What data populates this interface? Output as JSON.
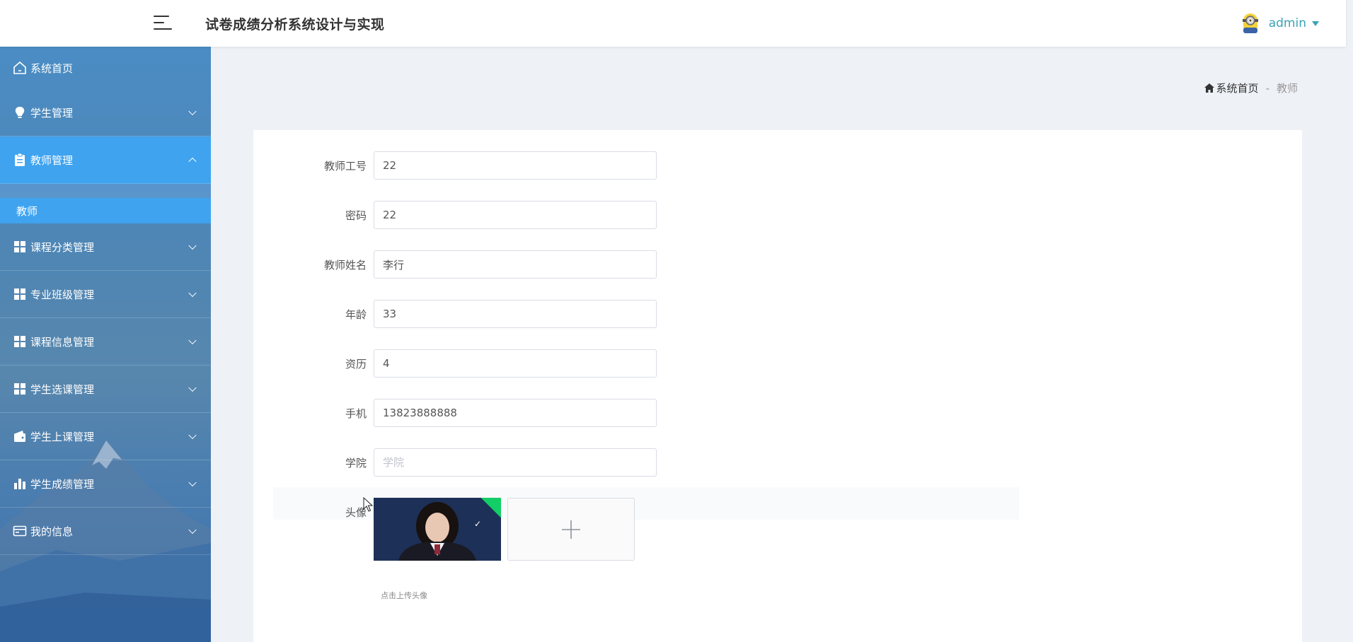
{
  "header": {
    "title": "试卷成绩分析系统设计与实现",
    "username": "admin"
  },
  "sidebar": {
    "items": [
      {
        "label": "系统首页",
        "icon": "home-icon"
      },
      {
        "label": "学生管理",
        "icon": "bulb-icon"
      },
      {
        "label": "教师管理",
        "icon": "clipboard-icon",
        "expanded": true
      },
      {
        "label": "课程分类管理",
        "icon": "grid-icon"
      },
      {
        "label": "专业班级管理",
        "icon": "grid-icon"
      },
      {
        "label": "课程信息管理",
        "icon": "grid-icon"
      },
      {
        "label": "学生选课管理",
        "icon": "grid-icon"
      },
      {
        "label": "学生上课管理",
        "icon": "wallet-icon"
      },
      {
        "label": "学生成绩管理",
        "icon": "bar-chart-icon"
      },
      {
        "label": "我的信息",
        "icon": "card-icon"
      }
    ],
    "submenu": {
      "label": "教师"
    }
  },
  "breadcrumb": {
    "home": "系统首页",
    "separator": "-",
    "current": "教师"
  },
  "form": {
    "fields": [
      {
        "label": "教师工号",
        "value": "22",
        "placeholder": ""
      },
      {
        "label": "密码",
        "value": "22",
        "placeholder": ""
      },
      {
        "label": "教师姓名",
        "value": "李行",
        "placeholder": ""
      },
      {
        "label": "年龄",
        "value": "33",
        "placeholder": ""
      },
      {
        "label": "资历",
        "value": "4",
        "placeholder": ""
      },
      {
        "label": "手机",
        "value": "13823888888",
        "placeholder": ""
      },
      {
        "label": "学院",
        "value": "",
        "placeholder": "学院"
      }
    ],
    "avatar": {
      "label": "头像",
      "tip": "点击上传头像"
    }
  },
  "colors": {
    "accent": "#3fa3ef",
    "success": "#13ce66",
    "username": "#3aa3b5"
  }
}
